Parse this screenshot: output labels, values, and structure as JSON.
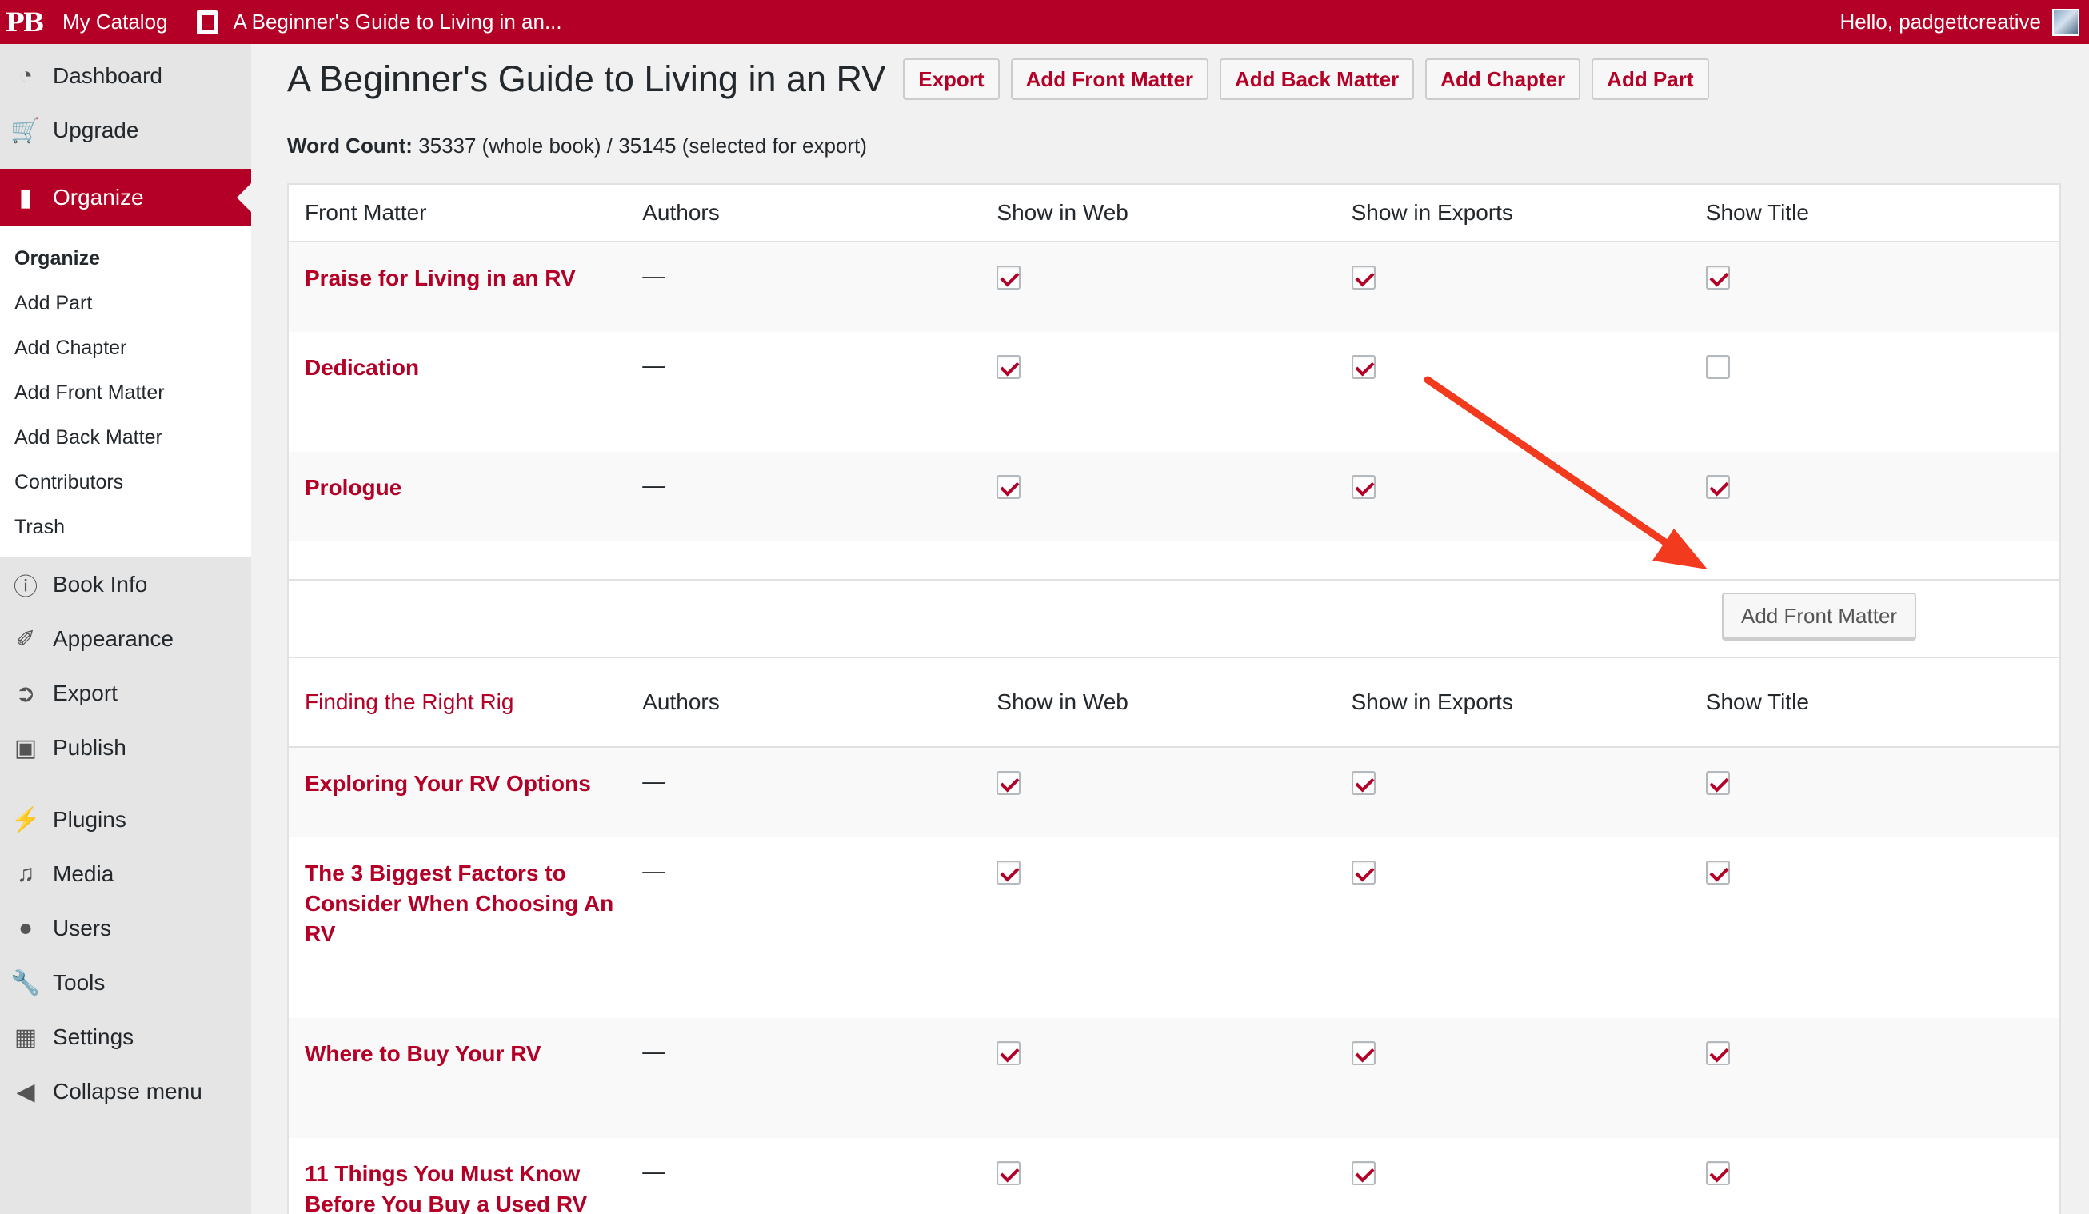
{
  "admin_bar": {
    "logo": "PB",
    "my_catalog": "My Catalog",
    "book_title": "A Beginner's Guide to Living in an...",
    "greeting": "Hello, padgettcreative"
  },
  "sidebar": {
    "dashboard": "Dashboard",
    "upgrade": "Upgrade",
    "organize": "Organize",
    "submenu": [
      "Organize",
      "Add Part",
      "Add Chapter",
      "Add Front Matter",
      "Add Back Matter",
      "Contributors",
      "Trash"
    ],
    "book_info": "Book Info",
    "appearance": "Appearance",
    "export": "Export",
    "publish": "Publish",
    "plugins": "Plugins",
    "media": "Media",
    "users": "Users",
    "tools": "Tools",
    "settings": "Settings",
    "collapse": "Collapse menu"
  },
  "page": {
    "title": "A Beginner's Guide to Living in an RV",
    "buttons": {
      "export": "Export",
      "add_front_matter": "Add Front Matter",
      "add_back_matter": "Add Back Matter",
      "add_chapter": "Add Chapter",
      "add_part": "Add Part"
    },
    "word_count_label": "Word Count:",
    "word_count_value": "35337 (whole book) / 35145 (selected for export)"
  },
  "front_matter_table": {
    "headers": {
      "title": "Front Matter",
      "authors": "Authors",
      "show_web": "Show in Web",
      "show_exports": "Show in Exports",
      "show_title": "Show Title"
    },
    "rows": [
      {
        "title": "Praise for Living in an RV",
        "authors": "—",
        "web": true,
        "exports": true,
        "show_title": true
      },
      {
        "title": "Dedication",
        "authors": "—",
        "web": true,
        "exports": true,
        "show_title": false
      },
      {
        "title": "Prologue",
        "authors": "—",
        "web": true,
        "exports": true,
        "show_title": true
      }
    ],
    "add_button": "Add Front Matter"
  },
  "part_table": {
    "headers": {
      "title": "Finding the Right Rig",
      "authors": "Authors",
      "show_web": "Show in Web",
      "show_exports": "Show in Exports",
      "show_title": "Show Title"
    },
    "rows": [
      {
        "title": "Exploring Your RV Options",
        "authors": "—",
        "web": true,
        "exports": true,
        "show_title": true
      },
      {
        "title": "The 3 Biggest Factors to Consider When Choosing An RV",
        "authors": "—",
        "web": true,
        "exports": true,
        "show_title": true
      },
      {
        "title": "Where to Buy Your RV",
        "authors": "—",
        "web": true,
        "exports": true,
        "show_title": true
      },
      {
        "title": "11 Things You Must Know Before You Buy a Used RV",
        "authors": "—",
        "web": true,
        "exports": true,
        "show_title": true
      }
    ]
  },
  "colors": {
    "brand": "#b40026",
    "annotation_arrow": "#f23a1e"
  },
  "icons": [
    "dashboard-icon",
    "cart-icon",
    "book-icon",
    "info-icon",
    "brush-icon",
    "export-icon",
    "store-icon",
    "plug-icon",
    "media-icon",
    "user-icon",
    "wrench-icon",
    "sliders-icon",
    "collapse-icon",
    "avatar"
  ]
}
